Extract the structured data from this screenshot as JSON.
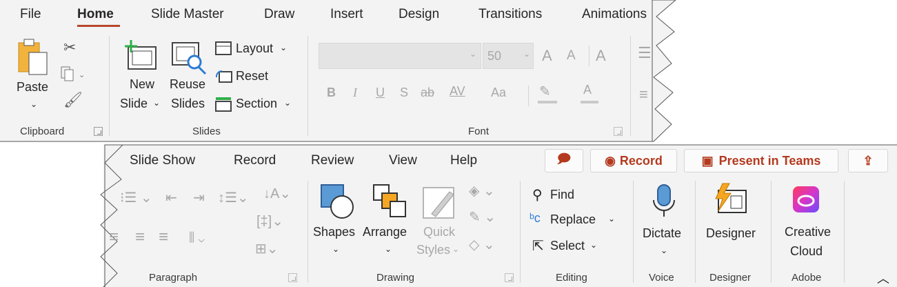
{
  "ribbon_top": {
    "tabs": [
      {
        "label": "File"
      },
      {
        "label": "Home"
      },
      {
        "label": "Slide Master"
      },
      {
        "label": "Draw"
      },
      {
        "label": "Insert"
      },
      {
        "label": "Design"
      },
      {
        "label": "Transitions"
      },
      {
        "label": "Animations"
      }
    ],
    "clipboard": {
      "paste": "Paste",
      "group": "Clipboard"
    },
    "slides": {
      "new_1": "New",
      "new_2": "Slide",
      "reuse_1": "Reuse",
      "reuse_2": "Slides",
      "layout": "Layout",
      "reset": "Reset",
      "section": "Section",
      "group": "Slides"
    },
    "font": {
      "size_value": "50",
      "bold": "B",
      "italic": "I",
      "underline": "U",
      "shadow": "S",
      "strike": "ab",
      "spacing": "AV",
      "case": "Aa",
      "grow": "A",
      "shrink": "A",
      "color_a": "A",
      "group": "Font"
    }
  },
  "ribbon_bottom": {
    "tabs": [
      {
        "label": "Slide Show"
      },
      {
        "label": "Record"
      },
      {
        "label": "Review"
      },
      {
        "label": "View"
      },
      {
        "label": "Help"
      }
    ],
    "record_button": "Record",
    "teams_button": "Present in Teams",
    "paragraph": {
      "group": "Paragraph"
    },
    "drawing": {
      "shapes": "Shapes",
      "arrange": "Arrange",
      "quick_1": "Quick",
      "quick_2": "Styles",
      "group": "Drawing"
    },
    "editing": {
      "find": "Find",
      "replace": "Replace",
      "select": "Select",
      "group": "Editing"
    },
    "voice": {
      "dictate": "Dictate",
      "group": "Voice"
    },
    "designer": {
      "designer": "Designer",
      "group": "Designer"
    },
    "adobe": {
      "cc_1": "Creative",
      "cc_2": "Cloud",
      "group": "Adobe"
    }
  },
  "colors": {
    "accent": "#b7472a",
    "panel": "#f3f3f3",
    "blue": "#4f8ad8",
    "orange": "#f5a623"
  }
}
